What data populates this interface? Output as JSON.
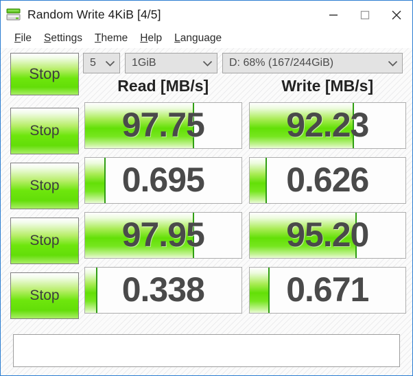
{
  "window": {
    "title": "Random Write 4KiB [4/5]",
    "icon": "disk-drive-icon",
    "controls": {
      "minimize": "minimize-icon",
      "maximize": "maximize-icon",
      "close": "close-icon"
    }
  },
  "menu": {
    "items": [
      {
        "accel": "F",
        "rest": "ile"
      },
      {
        "accel": "S",
        "rest": "ettings"
      },
      {
        "accel": "T",
        "rest": "heme"
      },
      {
        "accel": "H",
        "rest": "elp"
      },
      {
        "accel": "L",
        "rest": "anguage"
      }
    ]
  },
  "toolbar": {
    "main_button_label": "Stop",
    "test_count": "5",
    "test_size": "1GiB",
    "target_drive": "D: 68% (167/244GiB)",
    "chevron": "chevron-down-icon"
  },
  "headers": {
    "read": "Read [MB/s]",
    "write": "Write [MB/s]"
  },
  "rows": [
    {
      "button_label": "Stop",
      "read": "97.75",
      "write": "92.23",
      "read_fill": 70,
      "write_fill": 67
    },
    {
      "button_label": "Stop",
      "read": "0.695",
      "write": "0.626",
      "read_fill": 13,
      "write_fill": 11
    },
    {
      "button_label": "Stop",
      "read": "97.95",
      "write": "95.20",
      "read_fill": 70,
      "write_fill": 69
    },
    {
      "button_label": "Stop",
      "read": "0.338",
      "write": "0.671",
      "read_fill": 8,
      "write_fill": 13
    }
  ],
  "comment": {
    "value": "",
    "placeholder": ""
  },
  "colors": {
    "accent_green": "#63e007",
    "gauge_edge": "#2f9e12",
    "title_border": "#2b7dd1",
    "value_text": "#4a4a4a"
  }
}
